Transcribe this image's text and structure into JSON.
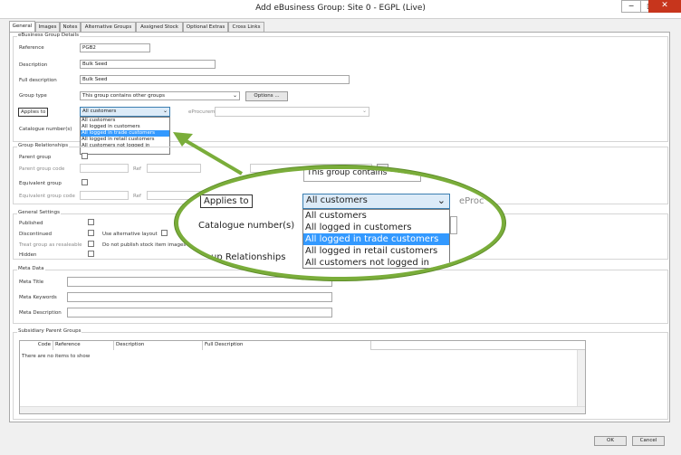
{
  "window": {
    "title": "Add eBusiness Group: Site 0 - EGPL (Live)",
    "minimize": "−",
    "maximize": "□",
    "close": "✕"
  },
  "tabs": [
    "General",
    "Images",
    "Notes",
    "Alternative Groups",
    "Assigned Stock",
    "Optional Extras",
    "Cross Links"
  ],
  "details": {
    "legend": "eBusiness Group Details",
    "reference_label": "Reference",
    "reference_value": "PGB2",
    "description_label": "Description",
    "description_value": "Bulk Seed",
    "full_description_label": "Full description",
    "full_description_value": "Bulk Seed",
    "group_type_label": "Group type",
    "group_type_value": "This group contains other groups",
    "options_button": "Options ...",
    "applies_to_label": "Applies to",
    "applies_to_value": "All customers",
    "eprocurement_label": "eProcurement",
    "catalogue_label": "Catalogue number(s)"
  },
  "applies_options": [
    "All customers",
    "All logged in customers",
    "All logged in trade customers",
    "All logged in retail customers",
    "All customers not logged in"
  ],
  "applies_highlight": 2,
  "relationships": {
    "legend": "Group Relationships",
    "parent_group": "Parent group",
    "parent_group_code": "Parent group code",
    "ref": "Ref",
    "equivalent_group": "Equivalent group",
    "equivalent_group_code": "Equivalent group code",
    "ref2": "Ref",
    "browse": "..."
  },
  "general_settings": {
    "legend": "General Settings",
    "published": "Published",
    "discontinued": "Discontinued",
    "use_alt_layout": "Use alternative layout",
    "treat_as_resaleable": "Treat group as resaleable",
    "not_publish_images": "Do not publish stock item images",
    "hidden": "Hidden"
  },
  "meta": {
    "legend": "Meta Data",
    "title": "Meta Title",
    "keywords": "Meta Keywords",
    "description": "Meta Description"
  },
  "subsidiary": {
    "legend": "Subsidiary Parent Groups",
    "columns": [
      "Code",
      "Reference",
      "Description",
      "Full Description"
    ],
    "empty": "There are no items to show"
  },
  "zoom": {
    "top_text": "This group contains",
    "applies_to": "Applies to",
    "applies_value": "All customers",
    "eprocurement": "eProc",
    "catalogue": "Catalogue number(s)",
    "relationships": "up Relationships"
  },
  "footer": {
    "ok": "OK",
    "cancel": "Cancel"
  },
  "colors": {
    "highlight": "#3399ff",
    "callout": "#7aad3a",
    "close": "#c7351c"
  }
}
